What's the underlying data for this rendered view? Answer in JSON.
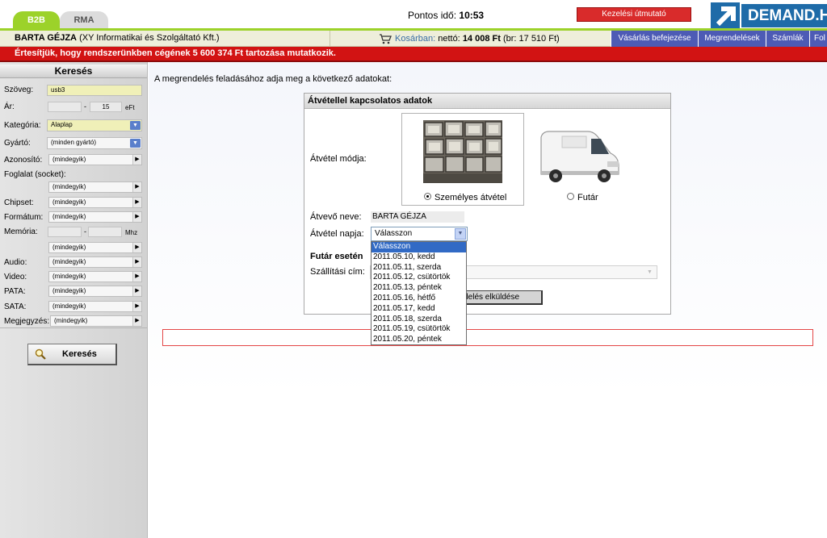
{
  "tabs": [
    {
      "label": "B2B"
    },
    {
      "label": "RMA"
    }
  ],
  "header": {
    "time_label": "Pontos idő:",
    "time_value": "10:53",
    "manual_button": "Kezelési útmutató",
    "logo_text": "DEMAND.H"
  },
  "user": {
    "name": "BARTA GÉJZA",
    "company": "(XY Informatikai és Szolgáltató Kft.)"
  },
  "cart": {
    "label": "Kosárban:",
    "net_label": "nettó:",
    "net_value": "14 008 Ft",
    "gross_text": "(br: 17 510 Ft)"
  },
  "nav": [
    {
      "label": "Vásárlás befejezése"
    },
    {
      "label": "Megrendelések"
    },
    {
      "label": "Számlák"
    },
    {
      "label": "Fol"
    }
  ],
  "alert": {
    "text": "Értesítjük, hogy rendszerünkben cégének 5 600 374 Ft tartozása mutatkozik."
  },
  "sidebar": {
    "title": "Keresés",
    "text_label": "Szöveg:",
    "text_value": "usb3",
    "price_label": "Ár:",
    "price_from": "",
    "price_sep": "-",
    "price_to": "15",
    "price_unit": "eFt",
    "category_label": "Kategória:",
    "category_value": "Alaplap",
    "maker_label": "Gyártó:",
    "maker_value": "(minden gyártó)",
    "id_label": "Azonosító:",
    "socket_label": "Foglalat (socket):",
    "chipset_label": "Chipset:",
    "format_label": "Formátum:",
    "memory_label": "Memória:",
    "memory_sep": "-",
    "memory_unit": "Mhz",
    "audio_label": "Audio:",
    "video_label": "Video:",
    "pata_label": "PATA:",
    "sata_label": "SATA:",
    "note_label": "Megjegyzés:",
    "any_value": "(mindegyik)",
    "search_button": "Keresés"
  },
  "main": {
    "intro": "A megrendelés feladásához adja meg a következő adatokat:",
    "panel_title": "Átvétellel kapcsolatos adatok",
    "mode_label": "Átvétel módja:",
    "personal_label": "Személyes átvétel",
    "courier_label": "Futár",
    "name_label": "Átvevő neve:",
    "name_value": "BARTA GÉJZA",
    "date_label": "Átvétel napja:",
    "date_value": "Válasszon",
    "courier_case": "Futár esetén",
    "address_label": "Szállítási cím:",
    "send_button": "endelés elküldése",
    "date_options": [
      "Válasszon",
      "2011.05.10, kedd",
      "2011.05.11, szerda",
      "2011.05.12, csütörtök",
      "2011.05.13, péntek",
      "2011.05.16, hétfő",
      "2011.05.17, kedd",
      "2011.05.18, szerda",
      "2011.05.19, csütörtök",
      "2011.05.20, péntek"
    ]
  },
  "colors": {
    "accent_green": "#9cd22a",
    "alert_red": "#d21313",
    "nav_blue": "#4d5bb5",
    "brand_blue": "#1e6ba8"
  }
}
